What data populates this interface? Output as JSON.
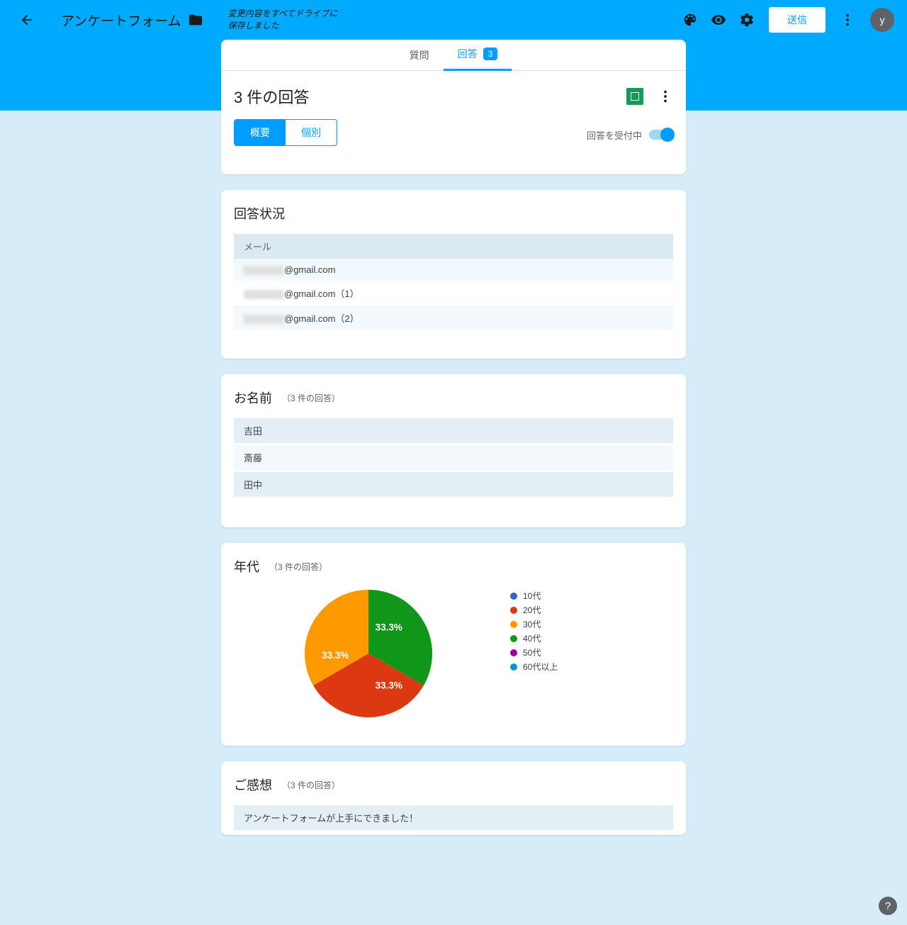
{
  "header": {
    "title": "アンケートフォーム",
    "save_msg_l1": "変更内容をすべてドライブに",
    "save_msg_l2": "保存しました",
    "send_label": "送信",
    "avatar_letter": "y"
  },
  "tabs": {
    "questions": "質問",
    "responses": "回答",
    "count": "3"
  },
  "responses": {
    "title": "3 件の回答",
    "summary_label": "概要",
    "individual_label": "個別",
    "accepting_label": "回答を受付中"
  },
  "status": {
    "heading": "回答状況",
    "col_email": "メール",
    "rows": [
      "@gmail.com",
      "@gmail.com（1）",
      "@gmail.com（2）"
    ]
  },
  "name": {
    "heading": "お名前",
    "sub": "（3 件の回答）",
    "rows": [
      "吉田",
      "斎藤",
      "田中"
    ]
  },
  "age": {
    "heading": "年代",
    "sub": "（3 件の回答）"
  },
  "feedback": {
    "heading": "ご感想",
    "sub": "（3 件の回答）",
    "rows": [
      "アンケートフォームが上手にできました！"
    ]
  },
  "chart_data": {
    "type": "pie",
    "title": "年代",
    "categories": [
      "10代",
      "20代",
      "30代",
      "40代",
      "50代",
      "60代以上"
    ],
    "values": [
      0,
      33.3,
      33.3,
      33.3,
      0,
      0
    ],
    "colors": [
      "#3366cc",
      "#dc3912",
      "#ff9900",
      "#109618",
      "#990099",
      "#0099c6"
    ],
    "slice_labels": [
      "33.3%",
      "33.3%",
      "33.3%"
    ]
  }
}
